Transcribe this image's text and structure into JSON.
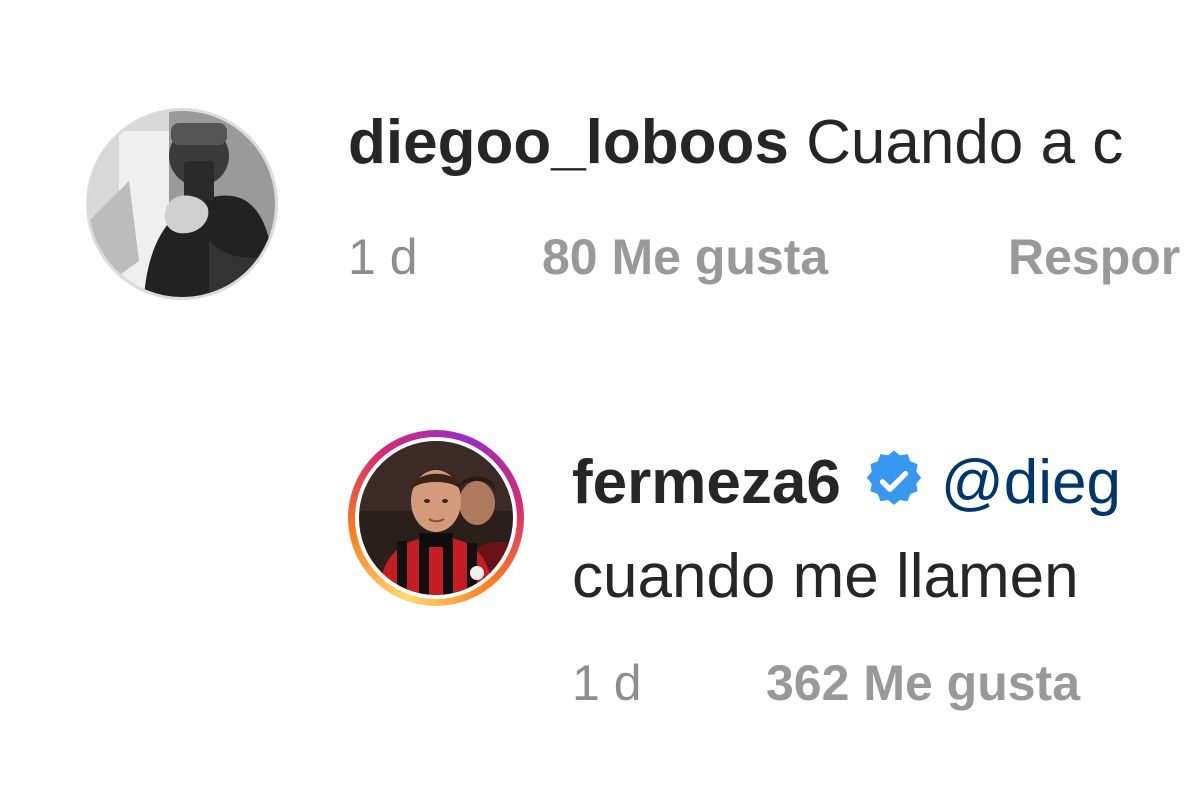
{
  "comments": [
    {
      "username": "diegoo_loboos",
      "text": "Cuando a c",
      "time": "1 d",
      "likes": "80 Me gusta",
      "reply": "Respor",
      "avatar_icon": "profile-photo-grayscale"
    },
    {
      "username": "fermeza6",
      "verified": true,
      "mention": "@dieg",
      "text": "cuando me llamen",
      "time": "1 d",
      "likes": "362 Me gusta",
      "avatar_icon": "profile-photo-football-player",
      "story_ring_colors": [
        "#feda75",
        "#fa7e1e",
        "#d62976",
        "#962fbf"
      ]
    }
  ],
  "colors": {
    "verified": "#3897f0",
    "mention": "#00376b",
    "meta": "#8e8e8e",
    "text": "#262626"
  }
}
